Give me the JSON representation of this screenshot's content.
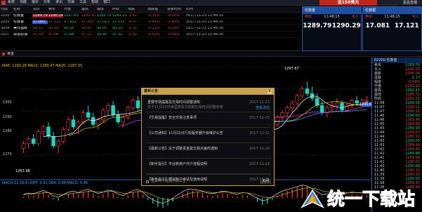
{
  "menubar": {
    "items": [
      "系统",
      "功能",
      "报价",
      "分析",
      "资讯",
      "交易",
      "工具",
      "帮助",
      "窗口"
    ],
    "ad_text": "送150美元",
    "right_text": "盈盈直播"
  },
  "quote_table": {
    "headers": [
      "代码",
      "名称",
      "买价",
      "卖价",
      "开盘",
      "最高",
      "最低",
      "昨收",
      "涨跌",
      "涨跌幅",
      "更新时间",
      "时间"
    ],
    "rows": [
      {
        "code": "2200",
        "name": "伦敦金",
        "bid": "1289.79",
        "ask": "1290.29",
        "open": "1287.63",
        "high": "1292.41",
        "low": "1285.72",
        "prev": "1291.21",
        "chg": "-1.42",
        "pct": "-0.11%",
        "pct2": "-0.20%",
        "time": "2017-11-23 11:48:15"
      },
      {
        "code": "2201",
        "name": "伦敦银",
        "bid": "17.081",
        "ask": "17.121",
        "open": "17.101",
        "high": "17.163",
        "low": "17.011",
        "prev": "17.151",
        "chg": "-0.07",
        "pct": "-0.41%",
        "pct2": "-1.80%",
        "time": "2017-11-23 11:48:15"
      },
      {
        "code": "3004",
        "name": "美元指数",
        "bid": "93.11",
        "ask": "93.14",
        "open": "93.16",
        "high": "93.25",
        "low": "93.05",
        "prev": "93.22",
        "chg": "-0.11",
        "pct": "-0.12%",
        "pct2": "-0.20%",
        "time": "2017-11-23 11:48:30"
      },
      {
        "code": "USTI",
        "name": "现货原油",
        "bid": "57.03",
        "ask": "57.06",
        "open": "57.68",
        "high": "57.71",
        "low": "56.95",
        "prev": "57.32",
        "chg": "-0.31",
        "pct": "-0.52%",
        "pct2": "-0.54%",
        "time": "2017-11-23 11:48:30"
      }
    ]
  },
  "panels": [
    {
      "title": "伦敦金",
      "time": "11:48:15",
      "bid_label": "卖出",
      "ask_label": "买入",
      "bid": "1289.79",
      "ask": "1290.29"
    },
    {
      "title": "伦敦银",
      "time": "11:48:15",
      "bid_label": "卖出",
      "ask_label": "买入",
      "bid": "17.081",
      "ask": "17.121"
    }
  ],
  "chart": {
    "header": "黄金",
    "indicator_line": "MA5: 1290.28   MA10: 1289.47   MA20: 1287.35",
    "macd_line": "MACD(12,26,9)  DIFF: 0.91  DEA: 0.68  MACD: 0.46",
    "y_labels": [
      "1300",
      "1290",
      "1280",
      "1270"
    ],
    "low_label": "1263.98",
    "high_label": "1297.67",
    "last_label": "1290.04",
    "colors": {
      "up": "#ff3b3b",
      "down": "#17d6c2",
      "ma1": "#ffffff",
      "ma2": "#e6c21a",
      "ma3": "#e040fb",
      "ma4": "#3fa9ff"
    }
  },
  "chart_data": {
    "type": "candlestick",
    "ylim": [
      1258,
      1304
    ],
    "ohlc": [
      [
        1270,
        1273,
        1268,
        1272
      ],
      [
        1272,
        1275,
        1270,
        1274
      ],
      [
        1274,
        1276,
        1271,
        1272
      ],
      [
        1272,
        1278,
        1271,
        1277
      ],
      [
        1277,
        1280,
        1275,
        1279
      ],
      [
        1279,
        1281,
        1274,
        1275
      ],
      [
        1275,
        1277,
        1270,
        1271
      ],
      [
        1271,
        1274,
        1268,
        1273
      ],
      [
        1273,
        1279,
        1272,
        1278
      ],
      [
        1278,
        1283,
        1277,
        1282
      ],
      [
        1282,
        1284,
        1278,
        1279
      ],
      [
        1279,
        1282,
        1276,
        1281
      ],
      [
        1281,
        1286,
        1280,
        1285
      ],
      [
        1285,
        1288,
        1282,
        1283
      ],
      [
        1283,
        1285,
        1279,
        1280
      ],
      [
        1280,
        1283,
        1278,
        1282
      ],
      [
        1282,
        1287,
        1281,
        1286
      ],
      [
        1286,
        1289,
        1284,
        1288
      ],
      [
        1288,
        1290,
        1283,
        1284
      ],
      [
        1284,
        1286,
        1280,
        1281
      ],
      [
        1281,
        1284,
        1279,
        1283
      ],
      [
        1283,
        1288,
        1282,
        1287
      ],
      [
        1287,
        1291,
        1286,
        1290
      ],
      [
        1290,
        1292,
        1286,
        1287
      ],
      [
        1287,
        1289,
        1283,
        1284
      ],
      [
        1284,
        1285,
        1278,
        1279
      ],
      [
        1279,
        1281,
        1274,
        1275
      ],
      [
        1275,
        1277,
        1270,
        1272
      ],
      [
        1272,
        1274,
        1267,
        1269
      ],
      [
        1269,
        1272,
        1266,
        1271
      ],
      [
        1271,
        1276,
        1270,
        1275
      ],
      [
        1275,
        1280,
        1274,
        1279
      ],
      [
        1279,
        1284,
        1278,
        1283
      ],
      [
        1283,
        1287,
        1282,
        1286
      ],
      [
        1286,
        1289,
        1284,
        1285
      ],
      [
        1285,
        1288,
        1283,
        1287
      ],
      [
        1287,
        1290,
        1284,
        1285
      ],
      [
        1285,
        1287,
        1281,
        1282
      ],
      [
        1282,
        1285,
        1280,
        1284
      ],
      [
        1284,
        1287,
        1283,
        1286
      ],
      [
        1286,
        1289,
        1285,
        1288
      ],
      [
        1288,
        1290,
        1285,
        1286
      ],
      [
        1286,
        1288,
        1282,
        1283
      ],
      [
        1283,
        1286,
        1281,
        1285
      ],
      [
        1285,
        1288,
        1284,
        1287
      ],
      [
        1287,
        1289,
        1283,
        1284
      ],
      [
        1284,
        1286,
        1280,
        1281
      ],
      [
        1281,
        1283,
        1277,
        1278
      ],
      [
        1278,
        1280,
        1273,
        1274
      ],
      [
        1274,
        1277,
        1271,
        1276
      ],
      [
        1276,
        1281,
        1275,
        1280
      ],
      [
        1280,
        1284,
        1279,
        1283
      ],
      [
        1283,
        1286,
        1281,
        1285
      ],
      [
        1285,
        1288,
        1283,
        1287
      ],
      [
        1287,
        1290,
        1285,
        1289
      ],
      [
        1289,
        1293,
        1288,
        1292
      ],
      [
        1292,
        1296,
        1291,
        1295
      ],
      [
        1295,
        1298,
        1292,
        1293
      ],
      [
        1293,
        1296,
        1290,
        1291
      ],
      [
        1291,
        1293,
        1287,
        1288
      ],
      [
        1288,
        1290,
        1284,
        1285
      ],
      [
        1285,
        1288,
        1283,
        1287
      ],
      [
        1287,
        1290,
        1285,
        1288
      ],
      [
        1288,
        1291,
        1286,
        1289
      ],
      [
        1289,
        1290,
        1285,
        1286
      ],
      [
        1286,
        1289,
        1285,
        1288
      ],
      [
        1288,
        1291,
        1287,
        1290
      ],
      [
        1290,
        1292,
        1288,
        1289
      ],
      [
        1289,
        1291,
        1287,
        1290
      ],
      [
        1290,
        1292,
        1288,
        1290
      ]
    ],
    "macd": [
      0.2,
      0.4,
      0.3,
      0.6,
      0.9,
      0.5,
      -0.2,
      -0.4,
      0.1,
      0.6,
      0.8,
      0.5,
      0.9,
      1.2,
      0.7,
      0.3,
      0.6,
      1.0,
      0.8,
      0.2,
      -0.1,
      0.4,
      0.9,
      1.1,
      0.6,
      -0.3,
      -0.9,
      -1.4,
      -1.6,
      -1.2,
      -0.6,
      0.1,
      0.7,
      1.2,
      1.1,
      1.0,
      0.8,
      0.4,
      0.3,
      0.5,
      0.8,
      0.7,
      0.3,
      0.2,
      0.5,
      0.4,
      -0.1,
      -0.6,
      -1.1,
      -0.9,
      -0.3,
      0.3,
      0.8,
      1.1,
      1.4,
      1.7,
      2.0,
      1.8,
      1.3,
      0.7,
      0.1,
      0.2,
      0.4,
      0.5,
      0.3,
      0.4,
      0.6,
      0.5,
      0.5,
      0.46
    ]
  },
  "side_panel": {
    "title": "02200 伦敦金",
    "lines": [
      {
        "k": "卖出",
        "v": "1289.79"
      },
      {
        "k": "买入",
        "v": "1290.29"
      },
      {
        "k": "最新",
        "v": "1290.04"
      },
      {
        "k": "涨跌",
        "v": "-1.17"
      },
      {
        "k": "幅度",
        "v": "-0.09%"
      },
      {
        "k": "开盘",
        "v": "1291.21"
      },
      {
        "k": "最高",
        "v": "1292.41"
      },
      {
        "k": "最低",
        "v": "1285.72"
      },
      {
        "k": "昨收",
        "v": "1291.21"
      },
      {
        "k": "11:48",
        "v": "1290.04"
      },
      {
        "k": "11:47",
        "v": "1290.11"
      },
      {
        "k": "11:47",
        "v": "1290.18"
      },
      {
        "k": "11:46",
        "v": "1290.02"
      },
      {
        "k": "11:46",
        "v": "1289.96"
      },
      {
        "k": "11:45",
        "v": "1289.88"
      },
      {
        "k": "11:45",
        "v": "1289.93"
      },
      {
        "k": "11:44",
        "v": "1290.07"
      },
      {
        "k": "11:44",
        "v": "1290.12"
      },
      {
        "k": "11:43",
        "v": "1290.05"
      },
      {
        "k": "11:43",
        "v": "1289.99"
      },
      {
        "k": "11:42",
        "v": "1289.91"
      },
      {
        "k": "11:42",
        "v": "1289.86"
      },
      {
        "k": "11:41",
        "v": "1289.94"
      },
      {
        "k": "11:41",
        "v": "1290.01"
      },
      {
        "k": "11:40",
        "v": "1290.08"
      },
      {
        "k": "11:40",
        "v": "1290.15"
      },
      {
        "k": "11:39",
        "v": "1290.10"
      },
      {
        "k": "11:39",
        "v": "1290.03"
      },
      {
        "k": "11:38",
        "v": "1289.97"
      },
      {
        "k": "11:38",
        "v": "1289.90"
      }
    ]
  },
  "dialog": {
    "title": "最新公告",
    "close": "×",
    "items": [
      {
        "title": "重要市场提醒及交易时间调整通知",
        "date": "2017-11-23",
        "sub": "关于11月23日美国感恩节假期交易时间调整安排",
        "link": "查看详情"
      },
      {
        "title": "【交易提醒】安全交易注意事项",
        "date": "2017-11-22",
        "sub": "",
        "link": ""
      },
      {
        "title": "【公司通知】11月22日行情服务器升级维护公告",
        "date": "2017-11-21",
        "sub": "",
        "link": ""
      },
      {
        "title": "【最新公告】关于调整贵金属交易点差的通知",
        "date": "2017-11-20",
        "sub": "",
        "link": ""
      },
      {
        "title": "【新手指引】平台新用户开户流程说明",
        "date": "2017-11-18",
        "sub": "",
        "link": ""
      },
      {
        "title": "【新手指引】模拟账户申请及使用说明",
        "date": "2017-11-15",
        "sub": "",
        "link": ""
      }
    ],
    "footer": "登录时不再显示此公告",
    "ok": "关闭"
  },
  "watermark": {
    "text": "统一下载站"
  }
}
